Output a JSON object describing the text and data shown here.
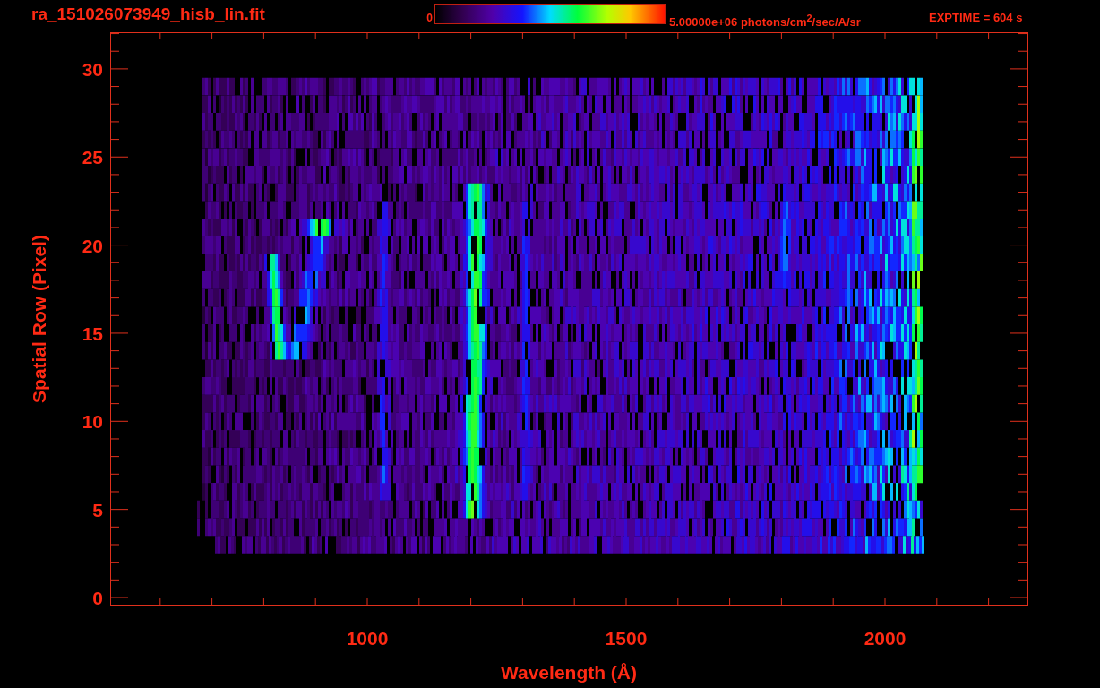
{
  "title": "ra_151026073949_hisb_lin.fit",
  "colorbar": {
    "min_label": "0",
    "max_label": "5.00000e+06 photons/cm$^{2}$/sec/A/sr"
  },
  "exposure": "EXPTIME = 604 s",
  "y_axis": {
    "label": "Spatial Row (Pixel)",
    "ticks": [
      "30",
      "25",
      "20",
      "15",
      "10",
      "5",
      "0"
    ]
  },
  "x_axis": {
    "label": "Wavelength (Å)",
    "ticks": [
      "1000",
      "1500",
      "2000"
    ]
  }
}
